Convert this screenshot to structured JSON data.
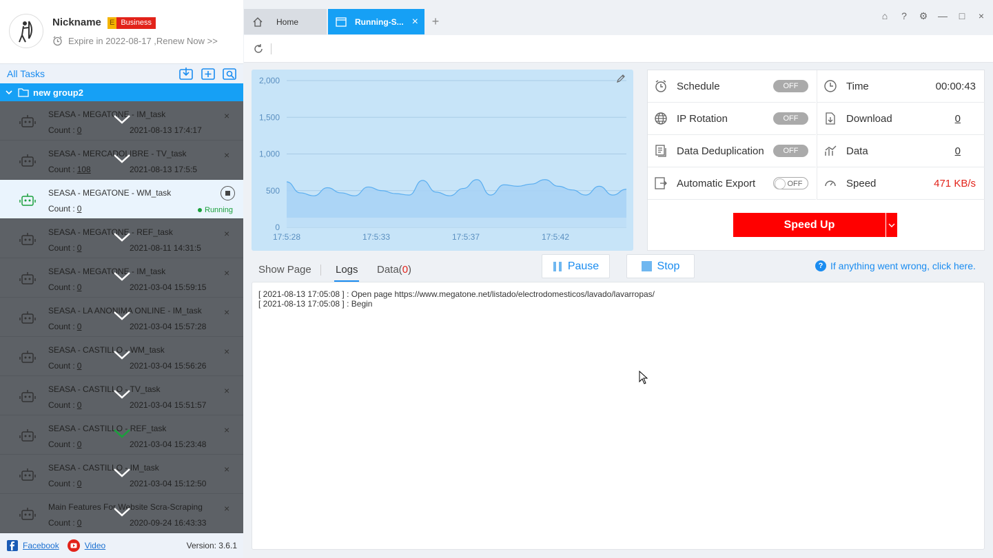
{
  "profile": {
    "nickname": "Nickname",
    "badge_letter": "E",
    "badge_label": "Business",
    "expire": "Expire in 2022-08-17 ,Renew Now >>"
  },
  "tasks_header": {
    "title": "All Tasks"
  },
  "group": {
    "name": "new group2"
  },
  "tasks": [
    {
      "name": "SEASA - MEGATONE - IM_task",
      "count": "0",
      "date": "2021-08-13 17:4:17"
    },
    {
      "name": "SEASA - MERCADOLIBRE - TV_task",
      "count": "108",
      "date": "2021-08-13 17:5:5"
    },
    {
      "name": "SEASA - MEGATONE - WM_task",
      "count": "0",
      "status": "Running"
    },
    {
      "name": "SEASA - MEGATONE - REF_task",
      "count": "0",
      "date": "2021-08-11 14:31:5"
    },
    {
      "name": "SEASA - MEGATONE - IM_task",
      "count": "0",
      "date": "2021-03-04 15:59:15"
    },
    {
      "name": "SEASA - LA ANONIMA ONLINE - IM_task",
      "count": "0",
      "date": "2021-03-04 15:57:28"
    },
    {
      "name": "SEASA - CASTILLO - WM_task",
      "count": "0",
      "date": "2021-03-04 15:56:26"
    },
    {
      "name": "SEASA - CASTILLO - TV_task",
      "count": "0",
      "date": "2021-03-04 15:51:57"
    },
    {
      "name": "SEASA - CASTILLO - REF_task",
      "count": "0",
      "date": "2021-03-04 15:23:48"
    },
    {
      "name": "SEASA - CASTILLO - IM_task",
      "count": "0",
      "date": "2021-03-04 15:12:50"
    },
    {
      "name": "Main Features For Website Scra-Scraping",
      "count": "0",
      "date": "2020-09-24 16:43:33"
    }
  ],
  "count_label": "Count :",
  "footer": {
    "facebook": "Facebook",
    "video": "Video",
    "version": "Version: 3.6.1"
  },
  "tabs": {
    "home": "Home",
    "running": "Running-S...",
    "add": "+"
  },
  "chart_data": {
    "type": "area",
    "y_ticks": [
      "2,000",
      "1,500",
      "1,000",
      "500",
      "0"
    ],
    "x_ticks": [
      "17:5:28",
      "17:5:33",
      "17:5:37",
      "17:5:42"
    ],
    "ylim": [
      0,
      2000
    ],
    "values": [
      620,
      470,
      430,
      540,
      470,
      430,
      550,
      500,
      460,
      440,
      640,
      480,
      430,
      530,
      650,
      440,
      580,
      560,
      590,
      650,
      560,
      510,
      440,
      560,
      440,
      520
    ]
  },
  "settings": {
    "schedule": {
      "label": "Schedule",
      "state": "OFF"
    },
    "ip_rotation": {
      "label": "IP Rotation",
      "state": "OFF"
    },
    "dedup": {
      "label": "Data Deduplication",
      "state": "OFF"
    },
    "export": {
      "label": "Automatic Export",
      "state": "OFF"
    }
  },
  "stats": {
    "time": {
      "label": "Time",
      "value": "00:00:43"
    },
    "download": {
      "label": "Download",
      "value": "0"
    },
    "data": {
      "label": "Data",
      "value": "0"
    },
    "speed": {
      "label": "Speed",
      "value": "471 KB/s"
    }
  },
  "speed_up": "Speed Up",
  "controls": {
    "show_page": "Show Page",
    "logs": "Logs",
    "data_label": "Data(",
    "data_count": "0",
    "data_close": ")",
    "pause": "Pause",
    "stop": "Stop",
    "help": "If anything went wrong, click here."
  },
  "logs": [
    "[ 2021-08-13 17:05:08 ] : Open page https://www.megatone.net/listado/electrodomesticos/lavado/lavarropas/",
    "[ 2021-08-13 17:05:08 ] : Begin"
  ],
  "colors": {
    "accent": "#16a0f5",
    "danger": "#ff0000",
    "running": "#1aa03c"
  }
}
